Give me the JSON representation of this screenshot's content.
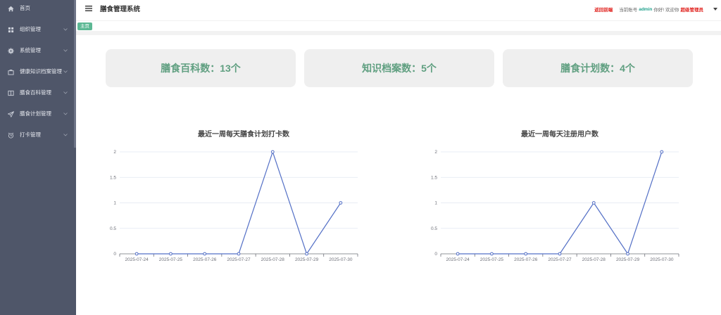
{
  "sidebar": {
    "items": [
      {
        "label": "首页",
        "icon": "home-icon",
        "expandable": false
      },
      {
        "label": "组织管理",
        "icon": "grid-icon",
        "expandable": true
      },
      {
        "label": "系统管理",
        "icon": "gear-icon",
        "expandable": true
      },
      {
        "label": "健康知识档案管理",
        "icon": "briefcase-icon",
        "expandable": true
      },
      {
        "label": "膳食百科管理",
        "icon": "book-icon",
        "expandable": true
      },
      {
        "label": "膳食计划管理",
        "icon": "paper-plane-icon",
        "expandable": true
      },
      {
        "label": "打卡管理",
        "icon": "alarm-clock-icon",
        "expandable": true
      }
    ]
  },
  "header": {
    "menu_icon": "hamburger-icon",
    "title": "膳食管理系统",
    "back_link": "返回前端",
    "account_label": "当前账号",
    "username": "admin",
    "greeting": "你好! 欢迎你",
    "role": "超级管理员",
    "dropdown_icon": "caret-down-icon"
  },
  "tabs": [
    {
      "label": "主页",
      "active": true
    }
  ],
  "stats": [
    {
      "label": "膳食百科数：",
      "value": "13",
      "unit": "个"
    },
    {
      "label": "知识档案数：",
      "value": "5",
      "unit": "个"
    },
    {
      "label": "膳食计划数：",
      "value": "4",
      "unit": "个"
    }
  ],
  "colors": {
    "sidebar_bg": "#4f5669",
    "tab_active": "#5cb894",
    "stat_text": "#5f9f80",
    "alert_red": "#e0201c",
    "username_teal": "#1fa08c"
  },
  "chart_data": [
    {
      "type": "line",
      "title": "最近一周每天膳食计划打卡数",
      "categories": [
        "2025-07-24",
        "2025-07-25",
        "2025-07-26",
        "2025-07-27",
        "2025-07-28",
        "2025-07-29",
        "2025-07-30"
      ],
      "values": [
        0,
        0,
        0,
        0,
        2,
        0,
        1
      ],
      "ylim": [
        0,
        2
      ],
      "yticks": [
        0,
        0.5,
        1,
        1.5,
        2
      ],
      "xlabel": "",
      "ylabel": "",
      "grid": true,
      "color": "#5470c6"
    },
    {
      "type": "line",
      "title": "最近一周每天注册用户数",
      "categories": [
        "2025-07-24",
        "2025-07-25",
        "2025-07-26",
        "2025-07-27",
        "2025-07-28",
        "2025-07-29",
        "2025-07-30"
      ],
      "values": [
        0,
        0,
        0,
        0,
        1,
        0,
        2
      ],
      "ylim": [
        0,
        2
      ],
      "yticks": [
        0,
        0.5,
        1,
        1.5,
        2
      ],
      "xlabel": "",
      "ylabel": "",
      "grid": true,
      "color": "#5470c6"
    }
  ]
}
